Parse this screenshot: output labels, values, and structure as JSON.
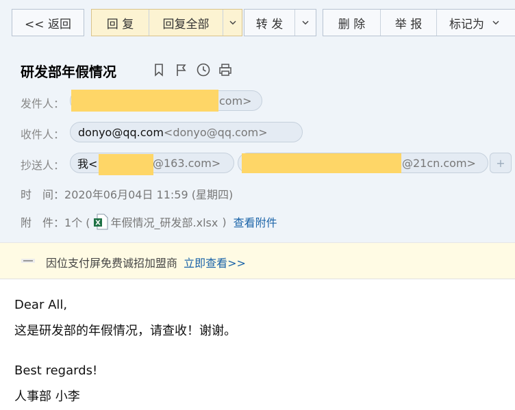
{
  "toolbar": {
    "back": "<< 返回",
    "reply": "回 复",
    "reply_all": "回复全部",
    "forward": "转 发",
    "delete": "删 除",
    "report": "举 报",
    "mark_as": "标记为"
  },
  "mail": {
    "subject": "研发部年假情况",
    "sender_label": "发件人：",
    "sender_suffix": "com>",
    "recipient_label": "收件人：",
    "recipient_name": "donyo@qq.com",
    "recipient_addr": "<donyo@qq.com>",
    "cc_label": "抄送人：",
    "cc1_name": "我<",
    "cc1_suffix": "@163.com>",
    "cc2_suffix": "@21cn.com>",
    "cc_more": "+",
    "time_label": "时　间：",
    "time_value": "2020年06月04日 11:59 (星期四)",
    "attach_label": "附　件：",
    "attach_count": "1个 (",
    "attach_file": "年假情况_研发部.xlsx",
    "attach_close": ")",
    "attach_link": "查看附件",
    "attach_icon_letter": "X"
  },
  "ad": {
    "text": "因位支付屏免费诚招加盟商",
    "link": "立即查看>>"
  },
  "content": {
    "greeting": "Dear All,",
    "line1": "这是研发部的年假情况，请查收！谢谢。",
    "regards": "Best regards!",
    "signature": "人事部 小李"
  },
  "colors": {
    "redaction": "#fed667",
    "link": "#1a63a8",
    "excel": "#1e7145"
  },
  "icons": [
    "bookmark-icon",
    "flag-icon",
    "clock-icon",
    "print-icon",
    "chevron-down-icon",
    "excel-file-icon"
  ]
}
